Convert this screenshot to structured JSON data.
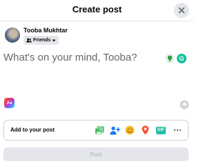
{
  "dialog": {
    "title": "Create post",
    "close_icon": "close-icon"
  },
  "user": {
    "name": "Tooba Mukhtar",
    "audience_label": "Friends",
    "audience_icon": "friends-icon",
    "audience_caret_icon": "caret-down-icon"
  },
  "composer": {
    "placeholder": "What's on your mind, Tooba?",
    "icons": [
      "emoji-picker-icon",
      "grammarly-icon"
    ]
  },
  "background_picker_label": "Aa",
  "emoji_icon": "smiley-icon",
  "add_to_post": {
    "label": "Add to your post",
    "tools": [
      {
        "name": "photo-video-icon",
        "color": "#45bd62"
      },
      {
        "name": "tag-people-icon",
        "color": "#1877f2"
      },
      {
        "name": "feeling-activity-icon",
        "color": "#f7b928"
      },
      {
        "name": "check-in-icon",
        "color": "#f5533d"
      },
      {
        "name": "gif-icon",
        "label": "GIF",
        "color": "#2abba7"
      },
      {
        "name": "more-icon",
        "color": "#65676b"
      }
    ]
  },
  "post_button_label": "Post",
  "colors": {
    "accent": "#1877f2",
    "disabled_bg": "#e4e6eb",
    "placeholder_text": "#65676b"
  }
}
